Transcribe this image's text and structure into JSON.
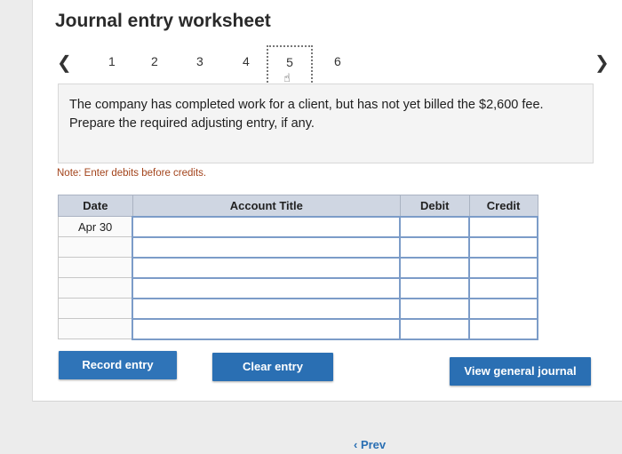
{
  "worksheet": {
    "title": "Journal entry worksheet",
    "nav": {
      "prev_icon": "chevron-left-icon",
      "next_icon": "chevron-right-icon",
      "steps": [
        "1",
        "2",
        "3",
        "4",
        "5",
        "6"
      ],
      "active_step": "5"
    },
    "question": "The company has completed work for a client, but has not yet billed the $2,600 fee. Prepare the required adjusting entry, if any.",
    "note": "Note: Enter debits before credits."
  },
  "table": {
    "headers": {
      "date": "Date",
      "account": "Account Title",
      "debit": "Debit",
      "credit": "Credit"
    },
    "rows": [
      {
        "date": "Apr 30"
      },
      {
        "date": ""
      },
      {
        "date": ""
      },
      {
        "date": ""
      },
      {
        "date": ""
      },
      {
        "date": ""
      }
    ]
  },
  "buttons": {
    "record": "Record entry",
    "clear": "Clear entry",
    "view": "View general journal"
  },
  "footer": {
    "prev_label": "Prev"
  },
  "colors": {
    "button": "#2a6fb3",
    "header": "#cfd6e2",
    "note": "#a3441c"
  }
}
